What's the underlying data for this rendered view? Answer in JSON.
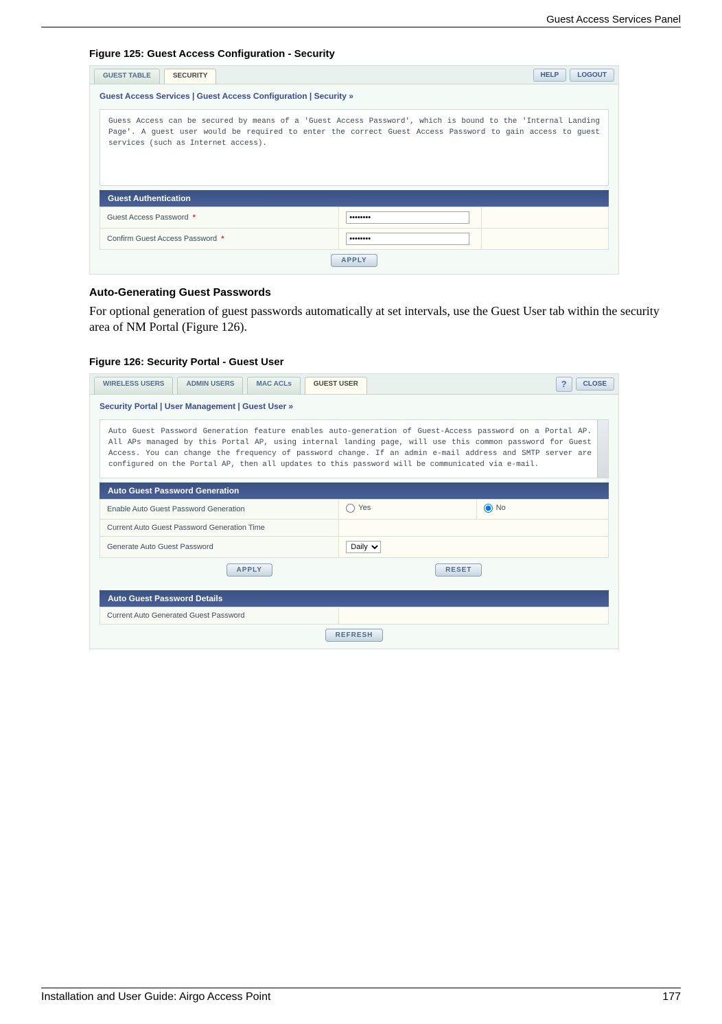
{
  "header": {
    "title": "Guest Access Services Panel"
  },
  "fig125": {
    "caption": "Figure 125:    Guest Access Configuration - Security",
    "tabs": {
      "inactive": "GUEST TABLE",
      "active": "SECURITY"
    },
    "help": "HELP",
    "logout": "LOGOUT",
    "breadcrumb": "Guest Access Services | Guest Access Configuration | Security  »",
    "desc": "Guess Access can be secured by means of a 'Guest Access Password', which is bound to the 'Internal Landing Page'. A guest user would be required to enter the correct Guest Access Password to gain access to guest services (such as Internet access).",
    "section": "Guest Authentication",
    "row1_label": "Guest Access Password",
    "row2_label": "Confirm Guest Access Password",
    "star": "*",
    "pw_mask": "●●●●●●●●",
    "apply": "APPLY"
  },
  "midsection": {
    "heading": "Auto-Generating Guest Passwords",
    "para": "For optional generation of guest passwords automatically at set intervals, use the Guest User tab within the security area of NM Portal (Figure 126)."
  },
  "fig126": {
    "caption": "Figure 126:    Security Portal - Guest User",
    "tabs": {
      "t1": "WIRELESS USERS",
      "t2": "ADMIN USERS",
      "t3": "MAC ACLs",
      "active": "GUEST USER"
    },
    "help_glyph": "?",
    "close": "CLOSE",
    "breadcrumb": "Security Portal | User Management | Guest User  »",
    "desc": "Auto Guest Password Generation feature enables auto-generation of Guest-Access password on a Portal AP. All APs managed by this Portal AP, using internal landing page, will use this common password for Guest Access. You can change the frequency of password change. If an admin e-mail address and SMTP server are configured on the Portal AP, then all updates to this password will be communicated via e-mail.",
    "section1": "Auto Guest Password Generation",
    "r1_label": "Enable Auto Guest Password Generation",
    "yes": "Yes",
    "no": "No",
    "r2_label": "Current Auto Guest Password Generation Time",
    "r3_label": "Generate Auto Guest Password",
    "freq_value": "Daily",
    "apply": "APPLY",
    "reset": "RESET",
    "section2": "Auto Guest Password Details",
    "r4_label": "Current Auto Generated Guest Password",
    "refresh": "REFRESH"
  },
  "footer": {
    "left": "Installation and User Guide: Airgo Access Point",
    "right": "177"
  }
}
